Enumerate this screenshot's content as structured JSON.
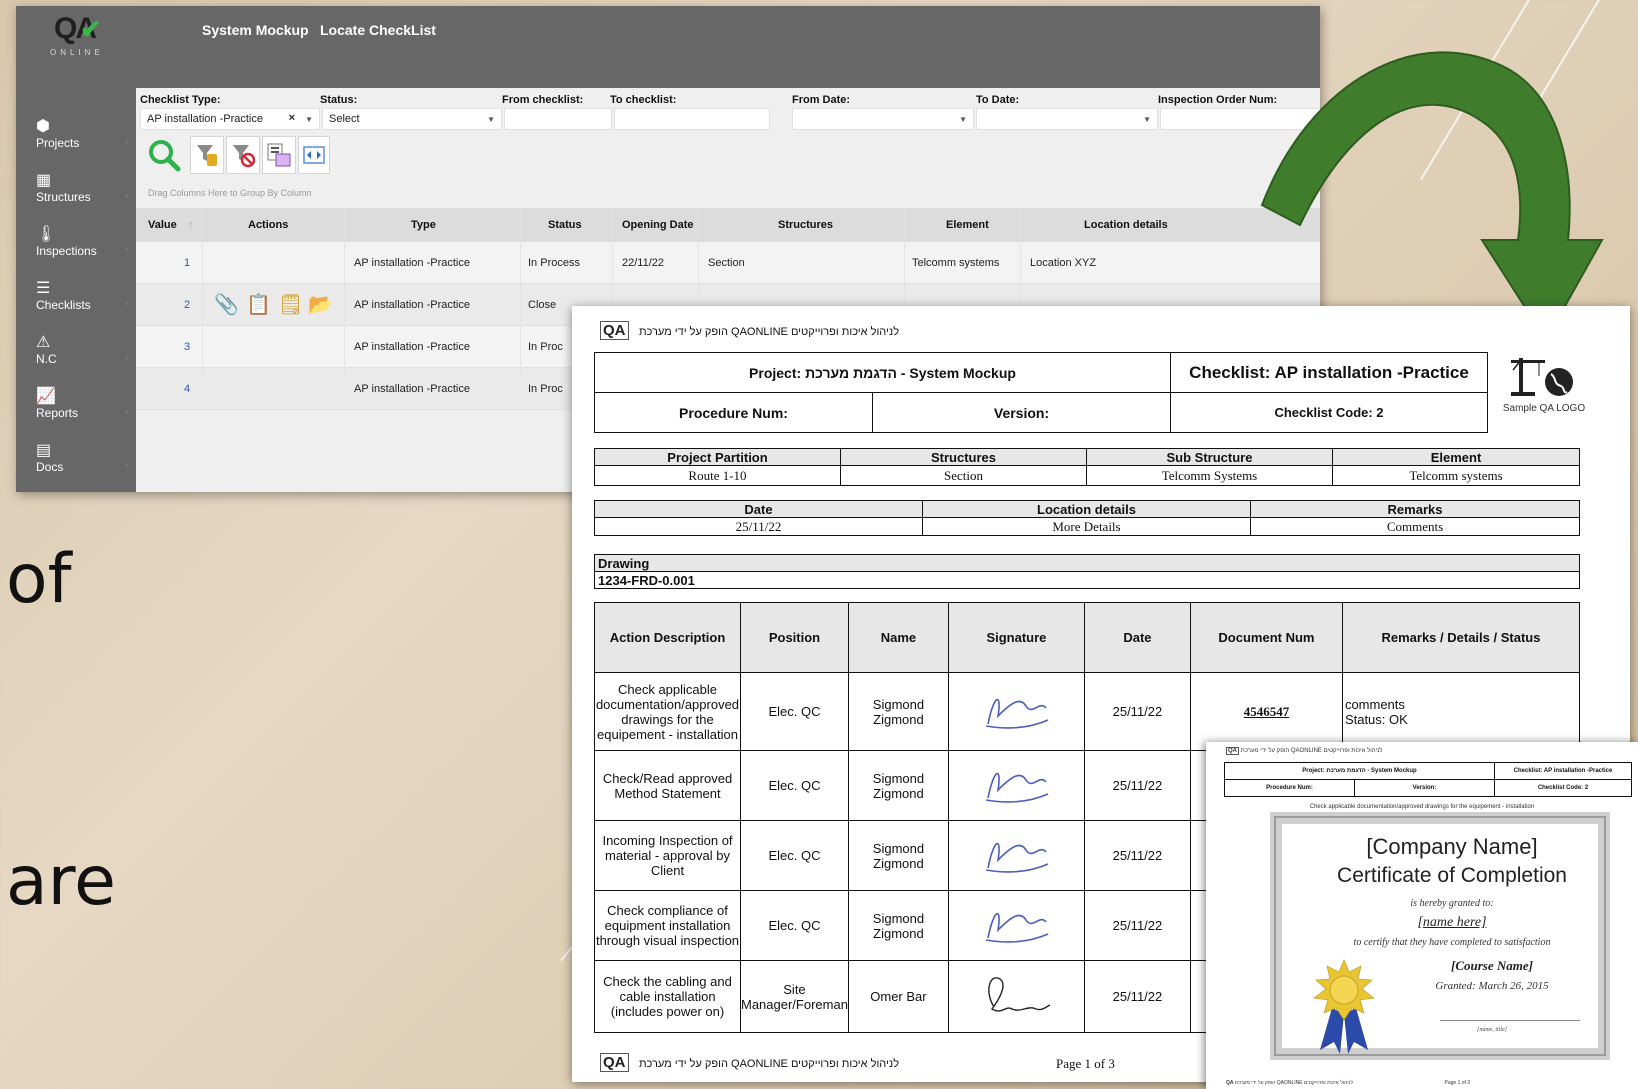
{
  "slide": {
    "side_words": [
      "of",
      "are"
    ]
  },
  "app": {
    "logo_text": "QA",
    "logo_sub": "ONLINE",
    "breadcrumb": [
      "System Mockup",
      "Locate CheckList"
    ],
    "sidebar": [
      {
        "label": "Projects",
        "icon": "cube-icon"
      },
      {
        "label": "Structures",
        "icon": "building-icon"
      },
      {
        "label": "Inspections",
        "icon": "thermometer-icon"
      },
      {
        "label": "Checklists",
        "icon": "list-icon"
      },
      {
        "label": "N.C",
        "icon": "warning-icon"
      },
      {
        "label": "Reports",
        "icon": "chart-icon"
      },
      {
        "label": "Docs",
        "icon": "document-icon"
      }
    ],
    "filters": {
      "checklist_type": {
        "label": "Checklist Type:",
        "value": "AP installation  -Practice"
      },
      "status": {
        "label": "Status:",
        "value": "Select"
      },
      "from_checklist": {
        "label": "From checklist:",
        "value": ""
      },
      "to_checklist": {
        "label": "To  checklist:",
        "value": ""
      },
      "from_date": {
        "label": "From Date:",
        "value": ""
      },
      "to_date": {
        "label": "To Date:",
        "value": ""
      },
      "inspection_order": {
        "label": "Inspection Order Num:",
        "value": ""
      }
    },
    "drag_hint": "Drag Columns Here to Group By Column",
    "grid": {
      "columns": [
        "Value",
        "Actions",
        "Type",
        "Status",
        "Opening Date",
        "Structures",
        "Element",
        "Location details"
      ],
      "rows": [
        {
          "value": "1",
          "type": "AP installation -Practice",
          "status": "In Process",
          "date": "22/11/22",
          "structures": "Section",
          "element": "Telcomm systems",
          "location": "Location XYZ"
        },
        {
          "value": "2",
          "type": "AP installation -Practice",
          "status": "Close",
          "date": "",
          "structures": "",
          "element": "",
          "location": ""
        },
        {
          "value": "3",
          "type": "AP installation -Practice",
          "status": "In Proc",
          "date": "",
          "structures": "",
          "element": "",
          "location": ""
        },
        {
          "value": "4",
          "type": "AP installation -Practice",
          "status": "In Proc",
          "date": "",
          "structures": "",
          "element": "",
          "location": ""
        }
      ]
    }
  },
  "report": {
    "header_note": "לניהול איכות ופרוייקטים QAONLINE הופק על ידי מערכת",
    "logo_caption": "Sample QA LOGO",
    "project": "Project: הדגמת מערכת - System Mockup",
    "checklist": "Checklist: AP installation -Practice",
    "procedure": "Procedure Num:",
    "version": "Version:",
    "checklist_code": "Checklist Code: 2",
    "partition_headers": [
      "Project Partition",
      "Structures",
      "Sub Structure",
      "Element"
    ],
    "partition_values": [
      "Route 1-10",
      "Section",
      "Telcomm Systems",
      "Telcomm systems"
    ],
    "date_headers": [
      "Date",
      "Location details",
      "Remarks"
    ],
    "date_values": [
      "25/11/22",
      "More Details",
      "Comments"
    ],
    "drawing_label": "Drawing",
    "drawing_value": "1234-FRD-0.001",
    "action_headers": [
      "Action Description",
      "Position",
      "Name",
      "Signature",
      "Date",
      "Document Num",
      "Remarks / Details / Status"
    ],
    "actions": [
      {
        "desc": "Check applicable documentation/approved drawings for the equipement - installation",
        "position": "Elec. QC",
        "name": "Sigmond Zigmond",
        "date": "25/11/22",
        "doc": "4546547",
        "remarks": "comments",
        "status": "Status: OK"
      },
      {
        "desc": "Check/Read approved Method Statement",
        "position": "Elec. QC",
        "name": "Sigmond Zigmond",
        "date": "25/11/22",
        "doc": "",
        "remarks": "",
        "status": ""
      },
      {
        "desc": "Incoming Inspection of material - approval by Client",
        "position": "Elec. QC",
        "name": "Sigmond Zigmond",
        "date": "25/11/22",
        "doc": "",
        "remarks": "",
        "status": ""
      },
      {
        "desc": "Check compliance of equipment installation through visual inspection",
        "position": "Elec. QC",
        "name": "Sigmond Zigmond",
        "date": "25/11/22",
        "doc": "",
        "remarks": "",
        "status": ""
      },
      {
        "desc": "Check the cabling and cable installation (includes power on)",
        "position": "Site Manager/Foreman",
        "name": "Omer Bar",
        "date": "25/11/22",
        "doc": "",
        "remarks": "",
        "status": ""
      }
    ],
    "footer_page": "Page 1 of 3"
  },
  "certificate": {
    "mini_header_note": "לניהול איכות ופרוייקטים QAONLINE הופק על ידי מערכת",
    "mini_project": "Project: הדגמת מערכת - System Mockup",
    "mini_checklist": "Checklist: AP installation -Practice",
    "mini_procedure": "Procedure Num:",
    "mini_version": "Version:",
    "mini_code": "Checklist Code: 2",
    "mini_caption": "Check applicable documentation/approved drawings for the equipement - installation",
    "company": "[Company Name]",
    "title": "Certificate of Completion",
    "granted_to": "is hereby granted to:",
    "name": "[name here]",
    "certify": "to certify that they have completed to satisfaction",
    "course": "[Course Name]",
    "granted_date": "Granted: March 26, 2015",
    "sign_caption": "[name, title]",
    "mini_footer_page": "Page 1 of 3"
  },
  "colors": {
    "arrow": "#3f7d2c",
    "header_bg": "#676767",
    "link_blue": "#2a56b8",
    "seal": "#e8c531"
  }
}
